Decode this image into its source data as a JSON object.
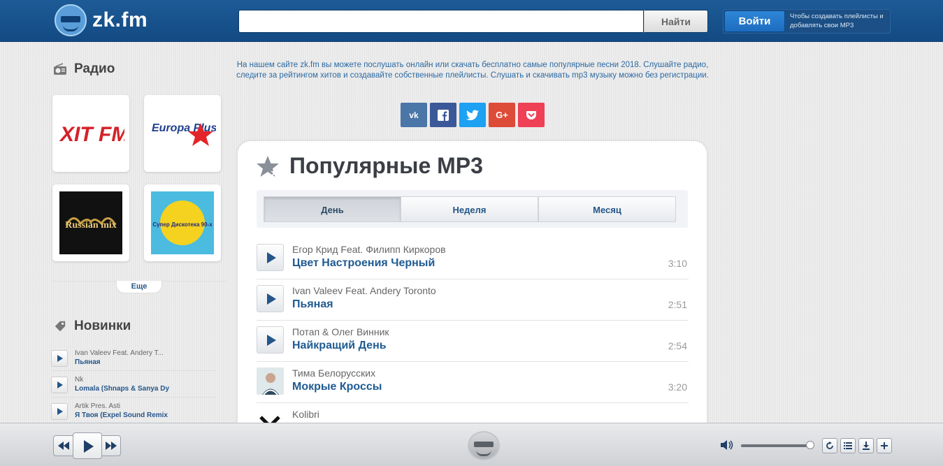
{
  "header": {
    "logo_text": "zk.fm",
    "search_placeholder": "",
    "search_button": "Найти",
    "login_button": "Войти",
    "login_hint": "Чтобы создавать плейлисты и добавлять свои MP3"
  },
  "sidebar": {
    "radio_title": "Радио",
    "radio_stations": [
      "XIT FM",
      "Europa Plus",
      "Russian mix",
      "Супер Дискотека 90-х"
    ],
    "more_label": "Еще",
    "new_title": "Новинки",
    "new_items": [
      {
        "artist": "Ivan Valeev Feat. Andery T...",
        "title": "Пьяная"
      },
      {
        "artist": "Nk",
        "title": "Lomala (Shnaps & Sanya Dy"
      },
      {
        "artist": "Artik Pres. Asti",
        "title": "Я Твоя (Expel Sound Remix"
      }
    ]
  },
  "main": {
    "intro": "На нашем сайте zk.fm вы можете послушать онлайн или скачать бесплатно самые популярные песни 2018. Слушайте радио, следите за рейтингом хитов и создавайте собственные плейлисты. Слушать и скачивать mp3 музыку можно без регистрации.",
    "share_buttons": [
      "vk",
      "facebook",
      "twitter",
      "google-plus",
      "pocket"
    ],
    "share_colors": [
      "#4a76a8",
      "#3b5998",
      "#1da1f2",
      "#dd4b39",
      "#ef4056"
    ],
    "panel_title": "Популярные MP3",
    "tabs": [
      "День",
      "Неделя",
      "Месяц"
    ],
    "active_tab": "День",
    "tracks": [
      {
        "artist": "Егор Крид Feat. Филипп Киркоров",
        "title": "Цвет Настроения Черный",
        "duration": "3:10"
      },
      {
        "artist": "Ivan Valeev Feat. Andery Toronto",
        "title": "Пьяная",
        "duration": "2:51"
      },
      {
        "artist": "Потап & Олег Винник",
        "title": "Найкращий День",
        "duration": "2:54"
      },
      {
        "artist": "Тима Белорусских",
        "title": "Мокрые Кроссы",
        "duration": "3:20"
      },
      {
        "artist": "Kolibri",
        "title": "",
        "duration": ""
      }
    ]
  },
  "player": {
    "volume_level": 0.95
  },
  "colors": {
    "brand_blue": "#1d5b97",
    "link_blue": "#1f5b92"
  }
}
